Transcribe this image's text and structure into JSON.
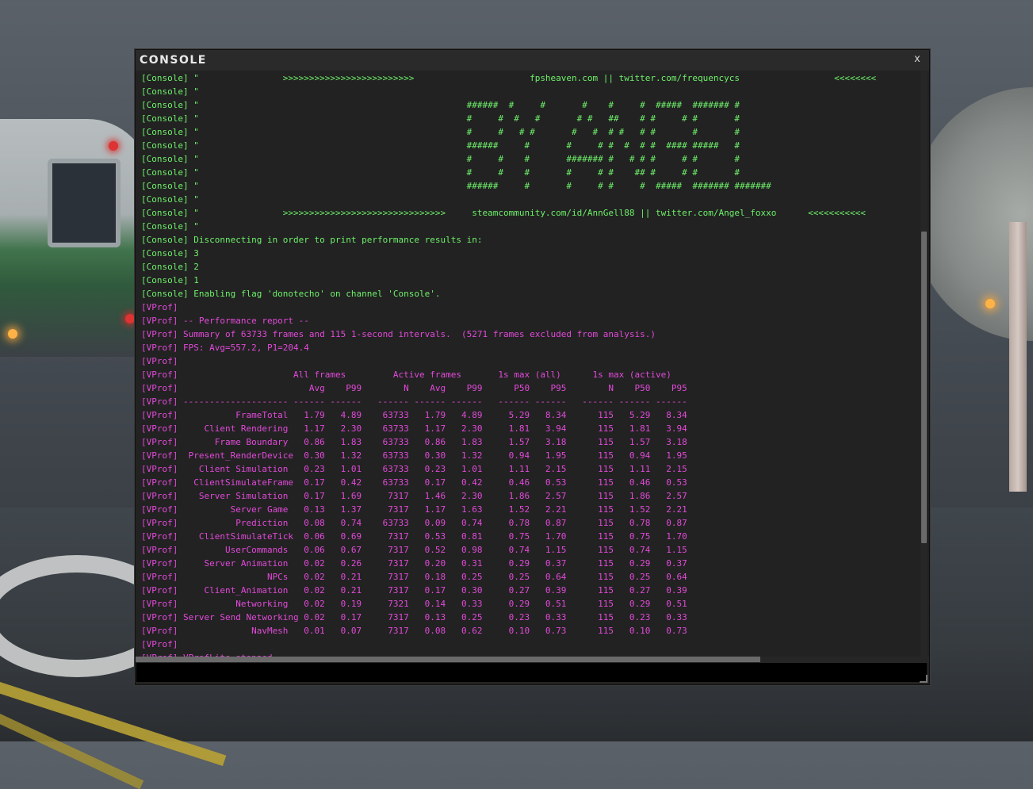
{
  "window": {
    "title": "CONSOLE",
    "close_label": "x",
    "input_value": ""
  },
  "colors": {
    "console_text": "#6ef06a",
    "vprof_text": "#e24ad9",
    "background": "#222222"
  },
  "console_lines": [
    {
      "text": "[Console] \"                >>>>>>>>>>>>>>>>>>>>>>>>>                      fpsheaven.com || twitter.com/frequencycs                  <<<<<<<<",
      "color": "green"
    },
    {
      "text": "[Console] \"",
      "color": "green"
    },
    {
      "text": "[Console] \"                                                   ######  #     #       #    #     #  #####  ####### #",
      "color": "green"
    },
    {
      "text": "[Console] \"                                                   #     #  #   #       # #   ##    # #     # #       #",
      "color": "green"
    },
    {
      "text": "[Console] \"                                                   #     #   # #       #   #  # #   # #       #       #",
      "color": "green"
    },
    {
      "text": "[Console] \"                                                   ######     #       #     # #  #  # #  #### #####   #",
      "color": "green"
    },
    {
      "text": "[Console] \"                                                   #     #    #       ####### #   # # #     # #       #",
      "color": "green"
    },
    {
      "text": "[Console] \"                                                   #     #    #       #     # #    ## #     # #       #",
      "color": "green"
    },
    {
      "text": "[Console] \"                                                   ######     #       #     # #     #  #####  ####### #######",
      "color": "green"
    },
    {
      "text": "[Console] \"",
      "color": "green"
    },
    {
      "text": "[Console] \"                >>>>>>>>>>>>>>>>>>>>>>>>>>>>>>>     steamcommunity.com/id/AnnGell88 || twitter.com/Angel_foxxo      <<<<<<<<<<<",
      "color": "green"
    },
    {
      "text": "[Console] \"",
      "color": "green"
    },
    {
      "text": "[Console] Disconnecting in order to print performance results in:",
      "color": "green"
    },
    {
      "text": "[Console] 3",
      "color": "green"
    },
    {
      "text": "[Console] 2",
      "color": "green"
    },
    {
      "text": "[Console] 1",
      "color": "green"
    },
    {
      "text": "[Console] Enabling flag 'donotecho' on channel 'Console'.",
      "color": "green"
    },
    {
      "text": "[VProf]",
      "color": "magenta"
    },
    {
      "text": "[VProf] -- Performance report --",
      "color": "magenta"
    },
    {
      "text": "[VProf] Summary of 63733 frames and 115 1-second intervals.  (5271 frames excluded from analysis.)",
      "color": "magenta"
    },
    {
      "text": "[VProf] FPS: Avg=557.2, P1=204.4",
      "color": "magenta"
    },
    {
      "text": "[VProf]",
      "color": "magenta"
    },
    {
      "text": "[VProf]                      All frames         Active frames       1s max (all)      1s max (active)",
      "color": "magenta"
    },
    {
      "text": "[VProf]                         Avg    P99        N    Avg    P99      P50    P95        N    P50    P95",
      "color": "magenta"
    },
    {
      "text": "[VProf] -------------------- ------ ------   ------ ------ ------   ------ ------   ------ ------ ------",
      "color": "magenta"
    },
    {
      "text": "[VProf]           FrameTotal   1.79   4.89    63733   1.79   4.89     5.29   8.34      115   5.29   8.34",
      "color": "magenta"
    },
    {
      "text": "[VProf]     Client Rendering   1.17   2.30    63733   1.17   2.30     1.81   3.94      115   1.81   3.94",
      "color": "magenta"
    },
    {
      "text": "[VProf]       Frame Boundary   0.86   1.83    63733   0.86   1.83     1.57   3.18      115   1.57   3.18",
      "color": "magenta"
    },
    {
      "text": "[VProf]  Present_RenderDevice  0.30   1.32    63733   0.30   1.32     0.94   1.95      115   0.94   1.95",
      "color": "magenta"
    },
    {
      "text": "[VProf]    Client Simulation   0.23   1.01    63733   0.23   1.01     1.11   2.15      115   1.11   2.15",
      "color": "magenta"
    },
    {
      "text": "[VProf]   ClientSimulateFrame  0.17   0.42    63733   0.17   0.42     0.46   0.53      115   0.46   0.53",
      "color": "magenta"
    },
    {
      "text": "[VProf]    Server Simulation   0.17   1.69     7317   1.46   2.30     1.86   2.57      115   1.86   2.57",
      "color": "magenta"
    },
    {
      "text": "[VProf]          Server Game   0.13   1.37     7317   1.17   1.63     1.52   2.21      115   1.52   2.21",
      "color": "magenta"
    },
    {
      "text": "[VProf]           Prediction   0.08   0.74    63733   0.09   0.74     0.78   0.87      115   0.78   0.87",
      "color": "magenta"
    },
    {
      "text": "[VProf]    ClientSimulateTick  0.06   0.69     7317   0.53   0.81     0.75   1.70      115   0.75   1.70",
      "color": "magenta"
    },
    {
      "text": "[VProf]         UserCommands   0.06   0.67     7317   0.52   0.98     0.74   1.15      115   0.74   1.15",
      "color": "magenta"
    },
    {
      "text": "[VProf]     Server Animation   0.02   0.26     7317   0.20   0.31     0.29   0.37      115   0.29   0.37",
      "color": "magenta"
    },
    {
      "text": "[VProf]                 NPCs   0.02   0.21     7317   0.18   0.25     0.25   0.64      115   0.25   0.64",
      "color": "magenta"
    },
    {
      "text": "[VProf]     Client_Animation   0.02   0.21     7317   0.17   0.30     0.27   0.39      115   0.27   0.39",
      "color": "magenta"
    },
    {
      "text": "[VProf]           Networking   0.02   0.19     7321   0.14   0.33     0.29   0.51      115   0.29   0.51",
      "color": "magenta"
    },
    {
      "text": "[VProf] Server Send Networking 0.02   0.17     7317   0.13   0.25     0.23   0.33      115   0.23   0.33",
      "color": "magenta"
    },
    {
      "text": "[VProf]              NavMesh   0.01   0.07     7317   0.08   0.62     0.10   0.73      115   0.10   0.73",
      "color": "magenta"
    },
    {
      "text": "[VProf]",
      "color": "magenta"
    },
    {
      "text": "[VProf] VProfLite stopped.",
      "color": "magenta"
    }
  ]
}
